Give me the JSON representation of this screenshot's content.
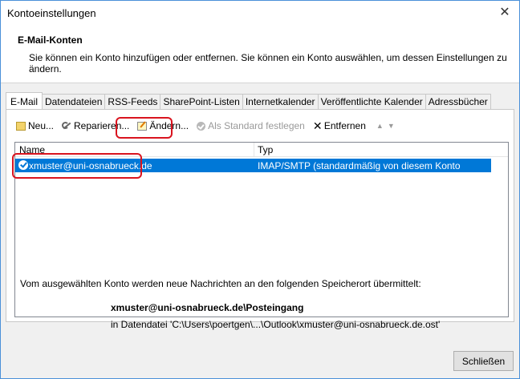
{
  "window": {
    "title": "Kontoeinstellungen"
  },
  "header": {
    "title": "E-Mail-Konten",
    "description": "Sie können ein Konto hinzufügen oder entfernen. Sie können ein Konto auswählen, um dessen Einstellungen zu ändern."
  },
  "tabs": [
    {
      "label": "E-Mail",
      "active": true
    },
    {
      "label": "Datendateien"
    },
    {
      "label": "RSS-Feeds"
    },
    {
      "label": "SharePoint-Listen"
    },
    {
      "label": "Internetkalender"
    },
    {
      "label": "Veröffentlichte Kalender"
    },
    {
      "label": "Adressbücher"
    }
  ],
  "toolbar": {
    "new": "Neu...",
    "repair": "Reparieren...",
    "change": "Ändern...",
    "set_default": "Als Standard festlegen",
    "remove": "Entfernen",
    "up_icon": "arrow-up",
    "down_icon": "arrow-down"
  },
  "list": {
    "col_name": "Name",
    "col_type": "Typ",
    "rows": [
      {
        "name": "xmuster@uni-osnabrueck.de",
        "type": "IMAP/SMTP (standardmäßig von diesem Konto senden)",
        "selected": true
      }
    ]
  },
  "delivery": {
    "info": "Vom ausgewählten Konto werden neue Nachrichten an den folgenden Speicherort übermittelt:",
    "location": "xmuster@uni-osnabrueck.de\\Posteingang",
    "datafile": "in Datendatei 'C:\\Users\\poertgen\\...\\Outlook\\xmuster@uni-osnabrueck.de.ost'"
  },
  "footer": {
    "close": "Schließen"
  },
  "colors": {
    "selection": "#0078d7",
    "highlight": "#d9141f",
    "dialog_bg": "#f0f0f0"
  }
}
